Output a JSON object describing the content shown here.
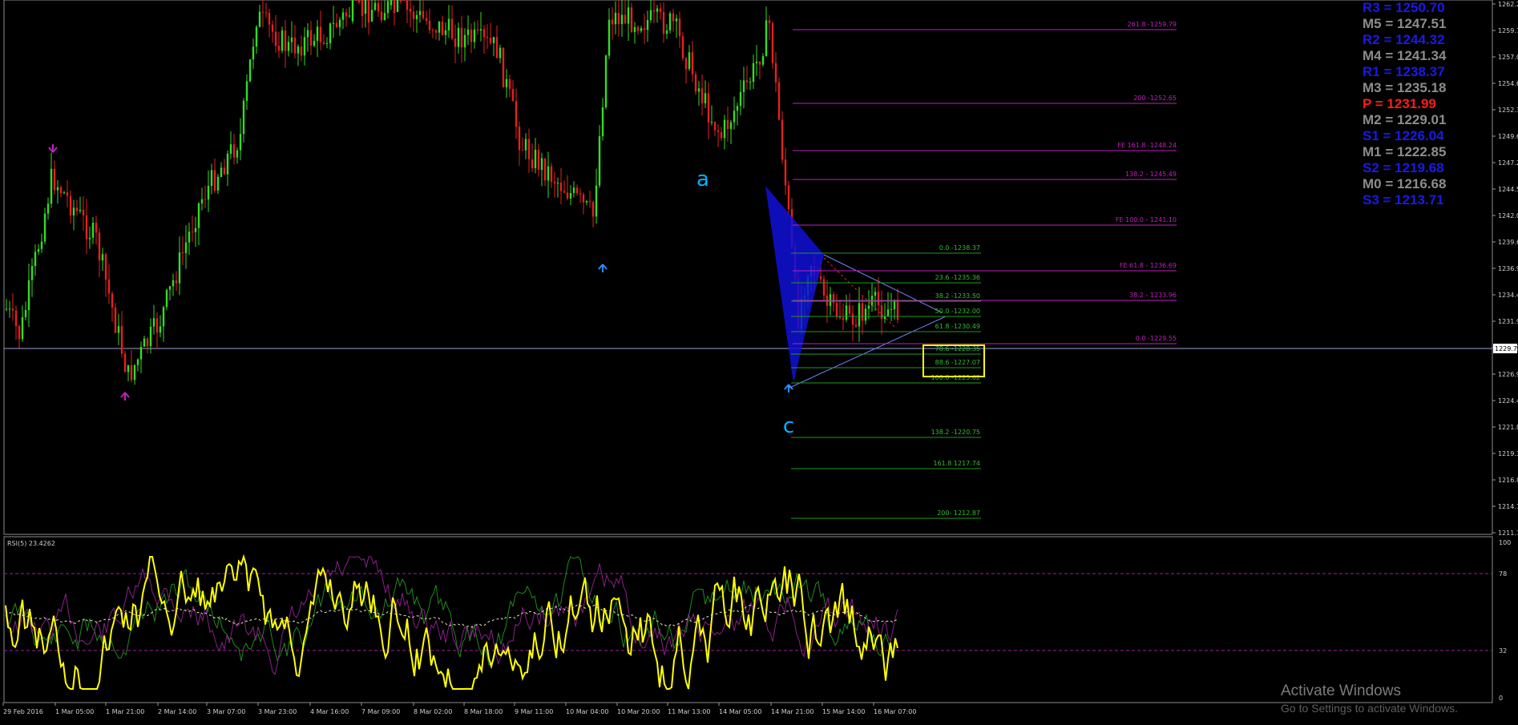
{
  "colors": {
    "background": "#000000",
    "bull_candle": "#33dd22",
    "bear_candle": "#e62020",
    "fib_magenta": "#c020c0",
    "fib_green": "#1f9a1f",
    "rsi_line": "#ffff00",
    "pattern_fill": "#1010d8",
    "label_cyan": "#00b4ff"
  },
  "price_axis": {
    "ticks": [
      "1262.2",
      "1259.7",
      "1257.0",
      "1254.6",
      "1252.3",
      "1249.6",
      "1247.2",
      "1244.5",
      "1242.0",
      "1239.6",
      "1236.9",
      "1234.4",
      "1231.9",
      "1229.7",
      "1226.9",
      "1224.4",
      "1221.8",
      "1219.3",
      "1216.8",
      "1214.1",
      "1211.7"
    ],
    "current_price": "1229.7"
  },
  "rsi_axis": {
    "ticks": [
      "100",
      "78",
      "32",
      "0"
    ]
  },
  "time_axis": {
    "labels": [
      "29 Feb 2016",
      "1 Mar 05:00",
      "1 Mar 21:00",
      "2 Mar 14:00",
      "3 Mar 07:00",
      "3 Mar 23:00",
      "4 Mar 16:00",
      "7 Mar 09:00",
      "8 Mar 02:00",
      "8 Mar 18:00",
      "9 Mar 11:00",
      "10 Mar 04:00",
      "10 Mar 20:00",
      "11 Mar 13:00",
      "14 Mar 05:00",
      "14 Mar 21:00",
      "15 Mar 14:00",
      "16 Mar 07:00"
    ]
  },
  "indicator": {
    "label": "RSI(5) 23.4262"
  },
  "pattern_labels": {
    "a": "a",
    "c": "c"
  },
  "fib_magenta_levels": [
    "261.8 -1259.79",
    "200 -1252.65",
    "FE 161.8 -1248.24",
    "138.2 - 1245.49",
    "FE 100.0 - 1241.10",
    "FE 61.8 - 1236.69",
    "38.2 - 1233.96",
    "0.0 -1229.55"
  ],
  "fib_green_levels": [
    "0.0 -1238.37",
    "23.6 -1235.36",
    "38.2 -1233.50",
    "50.0 -1232.00",
    "61.8 -1230.49",
    "78.6 -1228.35",
    "88.6 -1227.07",
    "100.0 -1225.62",
    "138.2 -1220.75",
    "161.8 1217.74",
    "200- 1212.87"
  ],
  "pivots": [
    {
      "name": "R3",
      "text": "R3 = 1250.70",
      "color": "#1a1ae6"
    },
    {
      "name": "M5",
      "text": "M5 = 1247.51",
      "color": "#8c8c8c"
    },
    {
      "name": "R2",
      "text": "R2 = 1244.32",
      "color": "#1a1ae6"
    },
    {
      "name": "M4",
      "text": "M4 = 1241.34",
      "color": "#8c8c8c"
    },
    {
      "name": "R1",
      "text": "R1 = 1238.37",
      "color": "#1a1ae6"
    },
    {
      "name": "M3",
      "text": "M3 = 1235.18",
      "color": "#8c8c8c"
    },
    {
      "name": "P",
      "text": "P  = 1231.99",
      "color": "#ff1a1a"
    },
    {
      "name": "M2",
      "text": "M2 = 1229.01",
      "color": "#8c8c8c"
    },
    {
      "name": "S1",
      "text": "S1 = 1226.04",
      "color": "#1a1ae6"
    },
    {
      "name": "M1",
      "text": "M1 = 1222.85",
      "color": "#8c8c8c"
    },
    {
      "name": "S2",
      "text": "S2 = 1219.68",
      "color": "#1a1ae6"
    },
    {
      "name": "M0",
      "text": "M0 = 1216.68",
      "color": "#8c8c8c"
    },
    {
      "name": "S3",
      "text": "S3 = 1213.71",
      "color": "#1a1ae6"
    }
  ],
  "watermark": {
    "title": "Activate Windows",
    "subtitle": "Go to Settings to activate Windows."
  }
}
